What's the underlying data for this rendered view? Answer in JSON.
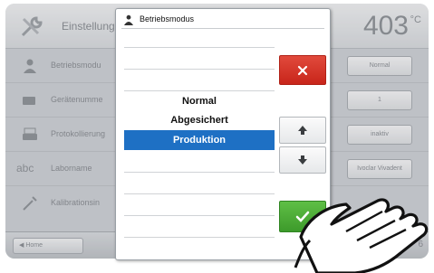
{
  "background": {
    "header": {
      "title": "Einstellung",
      "temperature": "403",
      "unit": "°C",
      "icon": "wrench-screwdriver-icon"
    },
    "rows": [
      {
        "label": "Betriebsmodu",
        "value": "Normal",
        "icon": "person-icon"
      },
      {
        "label": "Gerätenumme",
        "value": "1",
        "icon": "device-number-icon"
      },
      {
        "label": "Protokollierung",
        "value": "inaktiv",
        "icon": "printer-icon"
      },
      {
        "label": "Laborname",
        "value": "Ivoclar Vivadent",
        "icon": "abc-icon"
      },
      {
        "label": "Kalibrationsin",
        "value": "",
        "icon": "calibration-icon"
      }
    ],
    "footer": {
      "home_label": "Home",
      "page_number": "6"
    }
  },
  "dialog": {
    "title": "Betriebsmodus",
    "icon": "person-icon",
    "options": [
      "Normal",
      "Abgesichert",
      "Produktion"
    ],
    "selected_index": 2,
    "buttons": {
      "close": "close-icon",
      "up": "arrow-up-icon",
      "down": "arrow-down-icon",
      "confirm": "checkmark-icon"
    }
  },
  "colors": {
    "selection": "#1e70c4",
    "close_button": "#d7362a",
    "confirm_button": "#4caf3a",
    "dialog_bg": "#ffffff",
    "screen_bg": "#cfd2d6"
  }
}
